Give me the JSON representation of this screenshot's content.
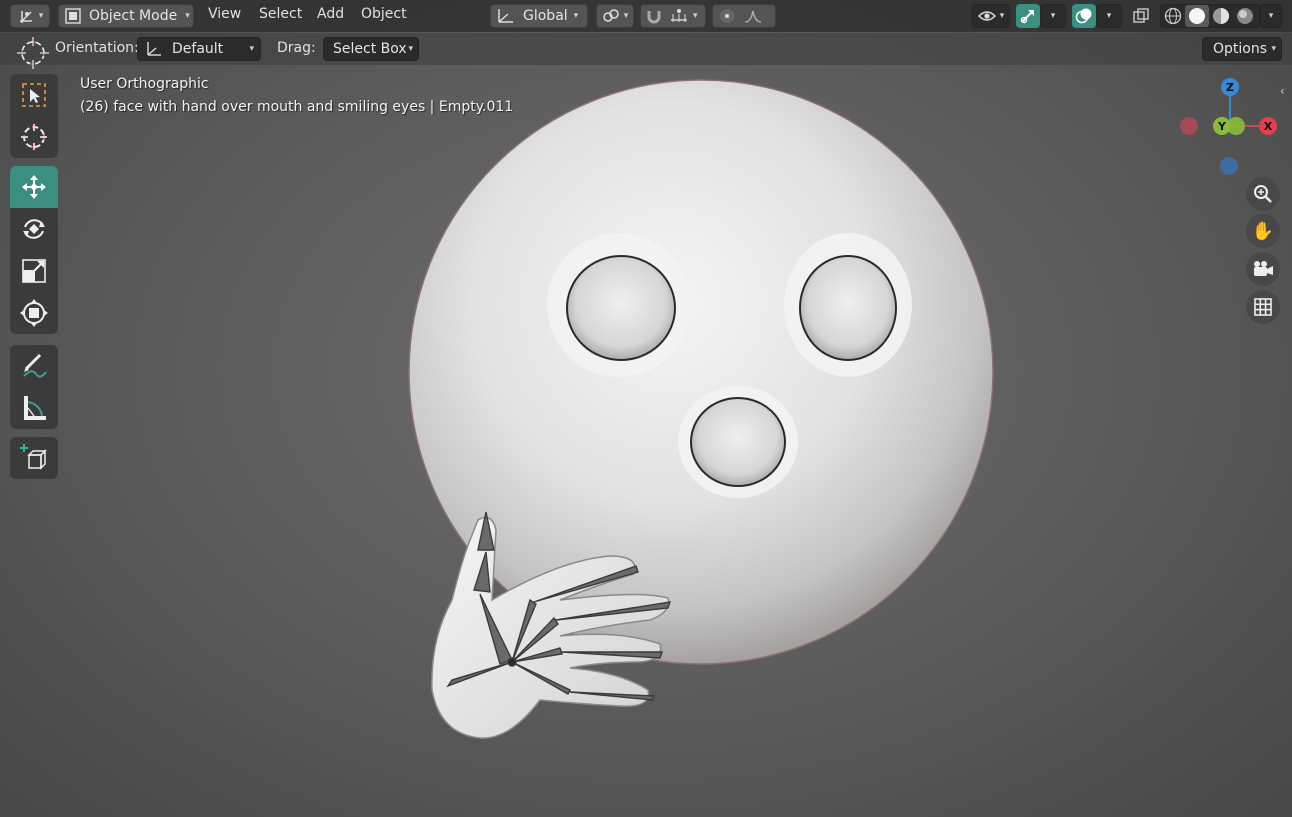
{
  "header": {
    "mode_label": "Object Mode",
    "menus": [
      "View",
      "Select",
      "Add",
      "Object"
    ],
    "transform_orientation": "Global",
    "options_label": "Options"
  },
  "tool_settings": {
    "orientation_label": "Orientation:",
    "orientation_value": "Default",
    "drag_label": "Drag:",
    "drag_value": "Select Box"
  },
  "viewport": {
    "view_name": "User Orthographic",
    "object_info": "(26) face with hand over mouth and smiling eyes | Empty.011"
  },
  "gizmo": {
    "x_label": "X",
    "y_label": "Y",
    "z_label": "Z",
    "x_color": "#e0404f",
    "y_color": "#8bbb3a",
    "z_color": "#3a87d6"
  },
  "toolbar": {
    "tools": [
      "select-box",
      "cursor",
      "move",
      "rotate",
      "scale",
      "transform",
      "annotate",
      "measure",
      "add-cube"
    ],
    "active_tool": "move"
  },
  "colors": {
    "accent": "#3a8f7e",
    "header_bg": "#303030",
    "viewport_bg": "#5e5e5e"
  }
}
